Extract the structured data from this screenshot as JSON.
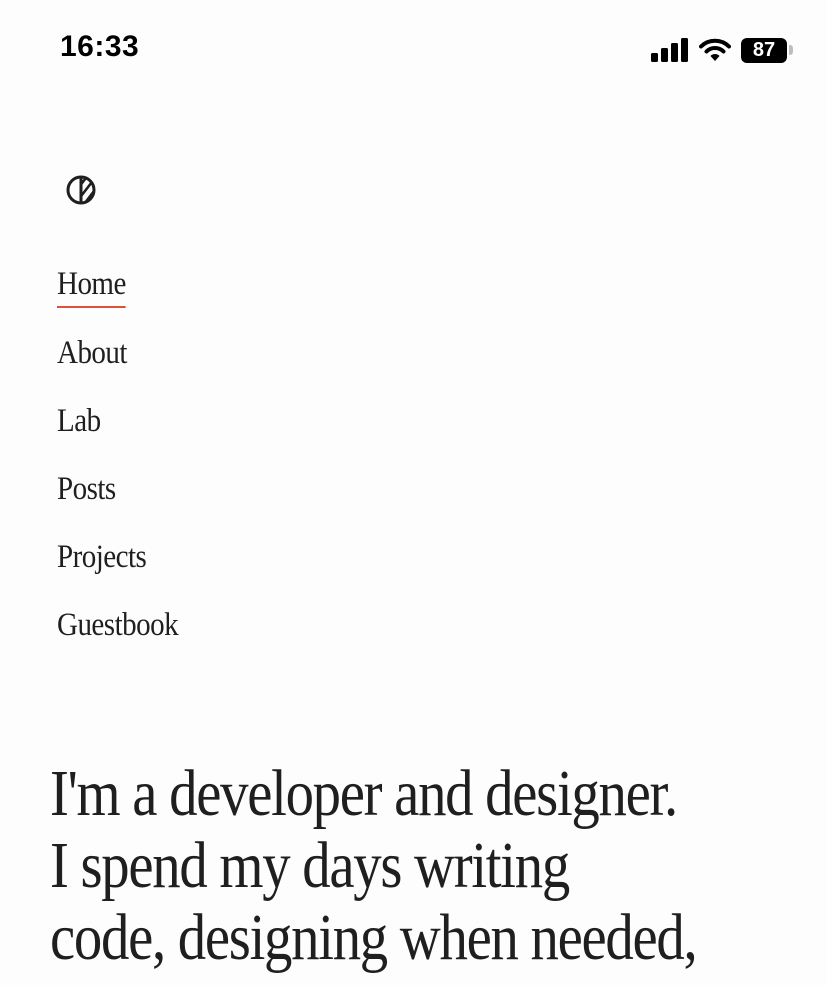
{
  "status_bar": {
    "time": "16:33",
    "battery_level": "87",
    "icons": [
      "signal-icon",
      "wifi-icon",
      "battery-icon"
    ]
  },
  "logo": {
    "icon": "half-circle-logo-icon"
  },
  "nav": {
    "active_color": "#e0513a",
    "items": [
      {
        "label": "Home",
        "active": true
      },
      {
        "label": "About",
        "active": false
      },
      {
        "label": "Lab",
        "active": false
      },
      {
        "label": "Posts",
        "active": false
      },
      {
        "label": "Projects",
        "active": false
      },
      {
        "label": "Guestbook",
        "active": false
      }
    ]
  },
  "hero": {
    "lines": [
      "I'm a developer and designer.",
      "I spend my days writing",
      "code, designing when needed,"
    ]
  }
}
